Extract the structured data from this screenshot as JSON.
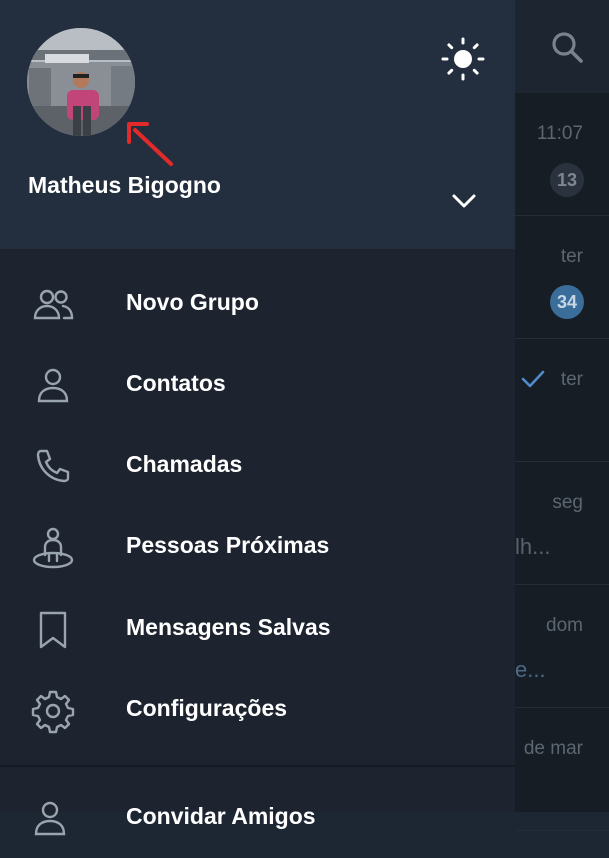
{
  "colors": {
    "drawer_bg": "#1d2430",
    "header_bg": "#232f3e",
    "icon": "#9aa4ae",
    "text": "#ffffff",
    "annotation_arrow": "#e32a2a",
    "badge_unread": "#3a6d99"
  },
  "background_chats": {
    "search_icon": "search-icon",
    "rows": [
      {
        "time": "11:07",
        "badge": "13",
        "badge_style": "muted",
        "preview": ""
      },
      {
        "time": "ter",
        "badge": "34",
        "badge_style": "unread",
        "preview": ""
      },
      {
        "time": "ter",
        "badge": "",
        "badge_style": "",
        "preview": "",
        "read_check": true
      },
      {
        "time": "seg",
        "badge": "",
        "badge_style": "",
        "preview": "lh..."
      },
      {
        "time": "dom",
        "badge": "",
        "badge_style": "",
        "preview": "e..."
      },
      {
        "time": "de mar",
        "badge": "",
        "badge_style": "",
        "preview": ""
      }
    ]
  },
  "drawer": {
    "header": {
      "user_name": "Matheus Bigogno",
      "theme_toggle_icon": "sun-icon",
      "expand_icon": "chevron-down-icon"
    },
    "menu": [
      {
        "label": "Novo Grupo",
        "icon": "group-icon"
      },
      {
        "label": "Contatos",
        "icon": "person-icon"
      },
      {
        "label": "Chamadas",
        "icon": "phone-icon"
      },
      {
        "label": "Pessoas Próximas",
        "icon": "nearby-people-icon"
      },
      {
        "label": "Mensagens Salvas",
        "icon": "bookmark-icon"
      },
      {
        "label": "Configurações",
        "icon": "gear-icon"
      }
    ],
    "footer_item": {
      "label": "Convidar Amigos",
      "icon": "add-person-icon"
    }
  }
}
